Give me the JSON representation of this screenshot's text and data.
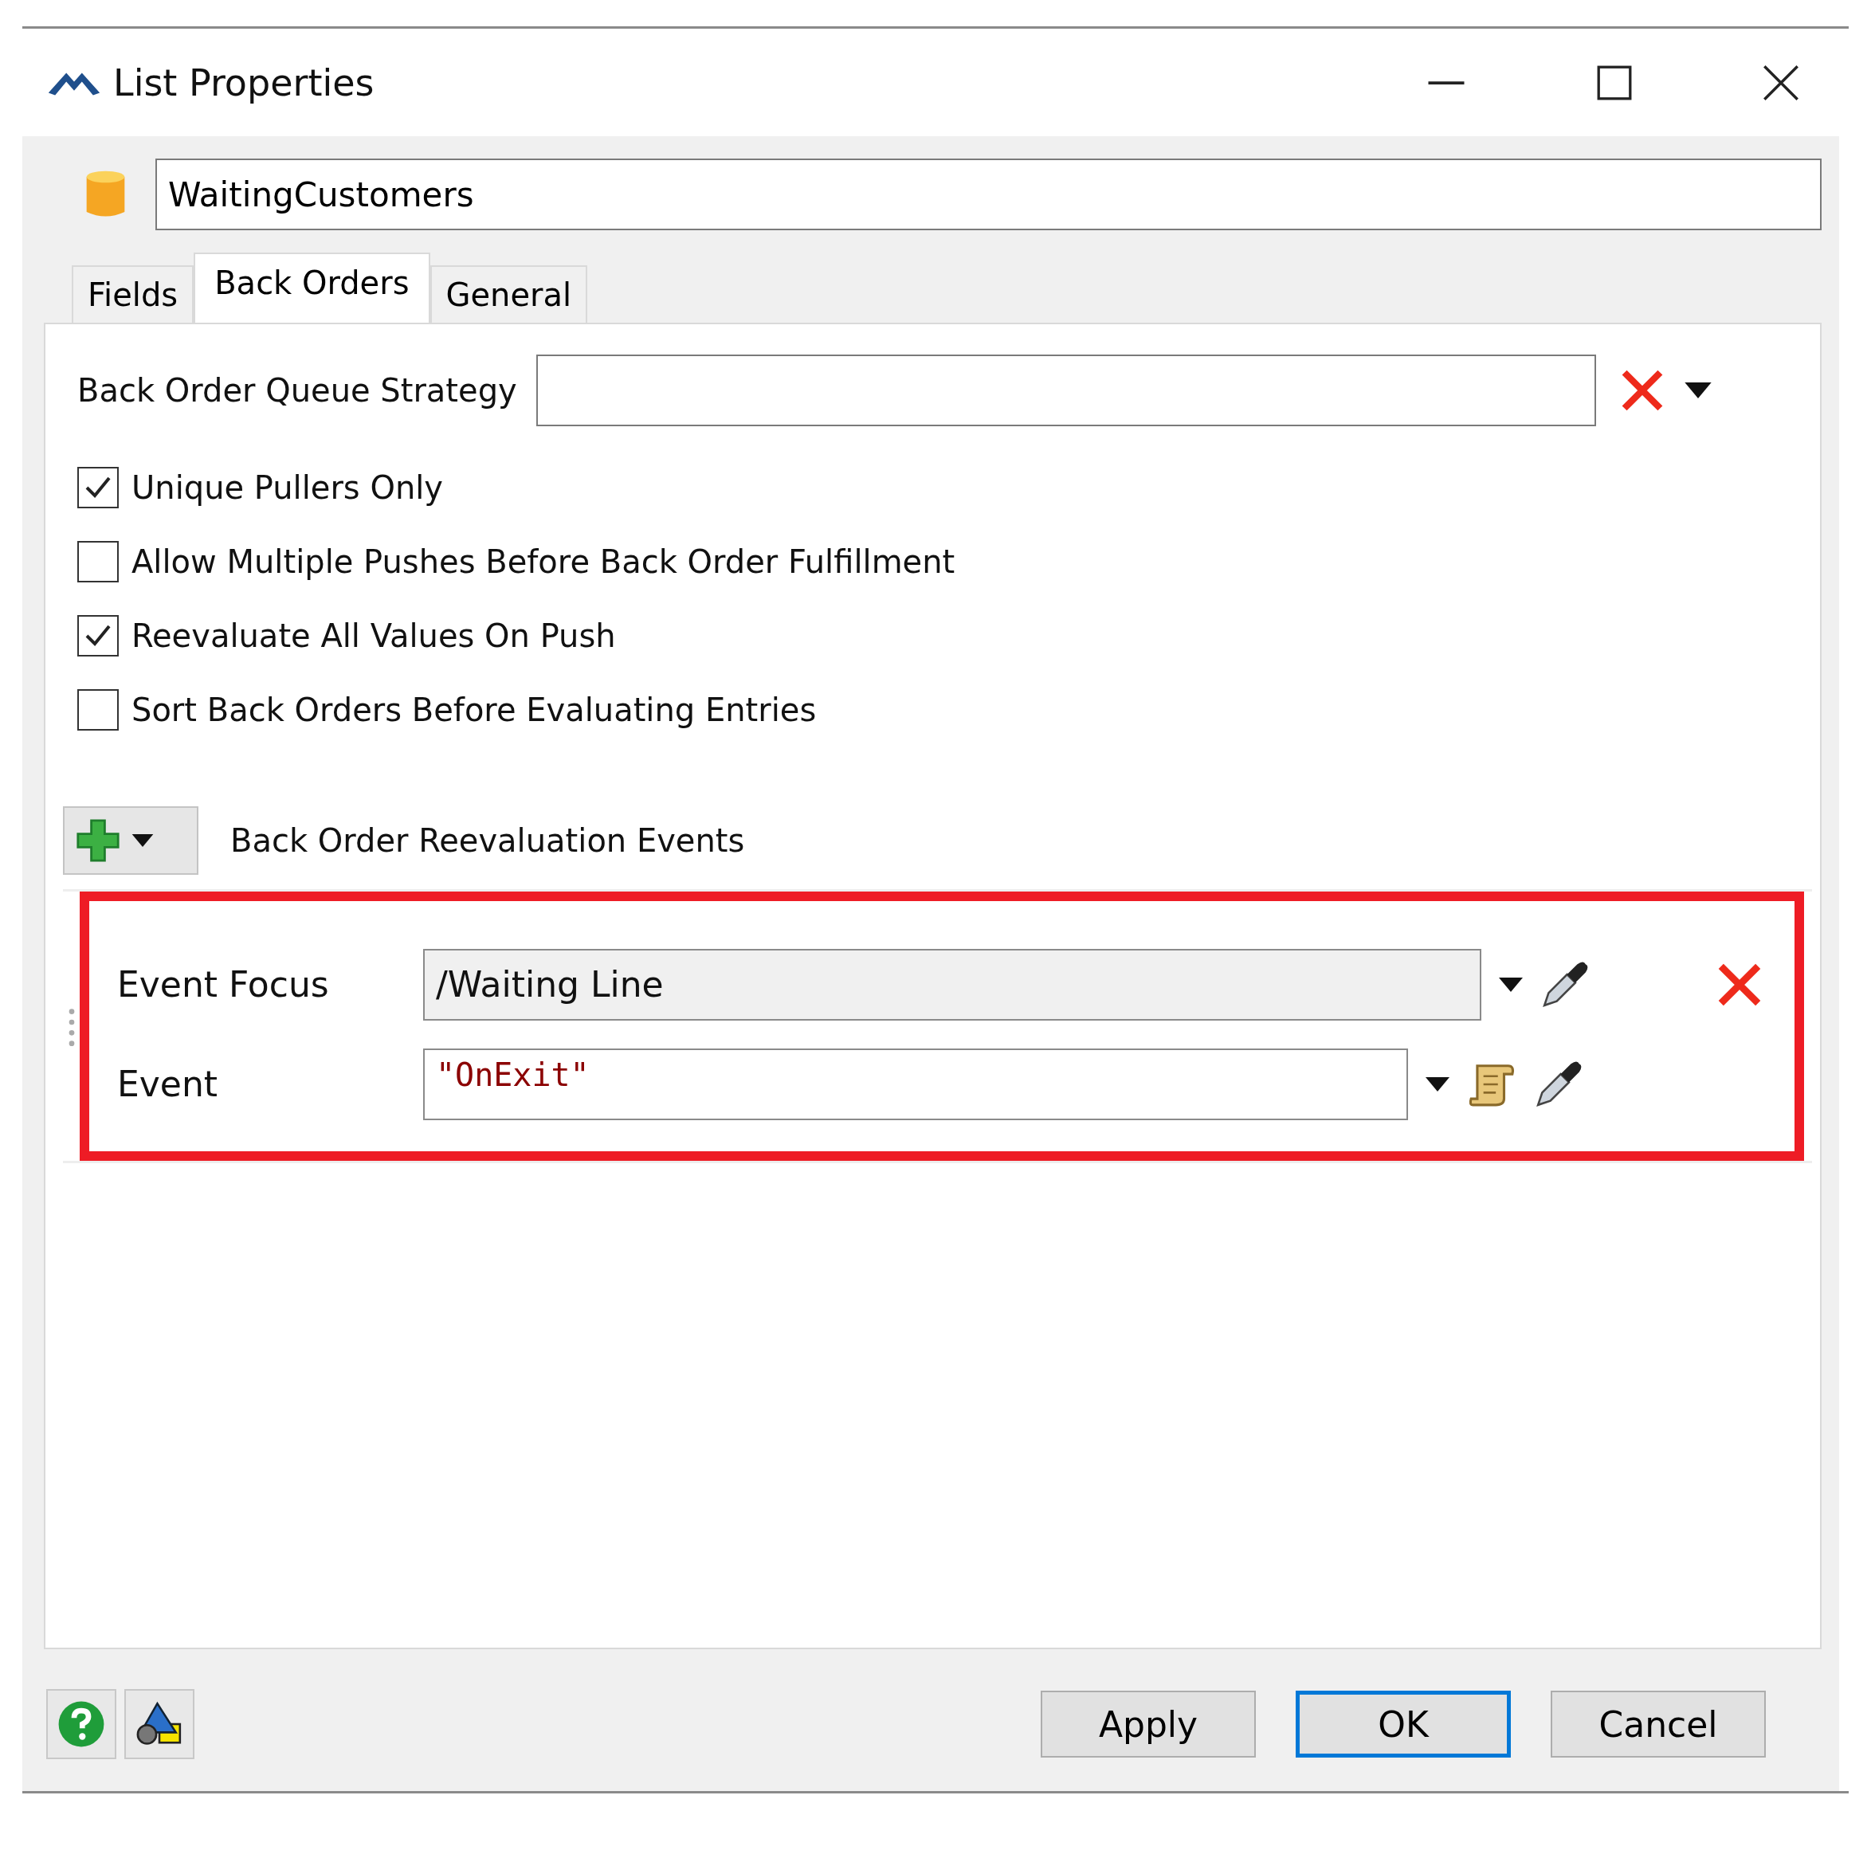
{
  "window": {
    "title": "List Properties"
  },
  "name_field": {
    "value": "WaitingCustomers"
  },
  "tabs": [
    {
      "label": "Fields",
      "selected": false
    },
    {
      "label": "Back Orders",
      "selected": true
    },
    {
      "label": "General",
      "selected": false
    }
  ],
  "queue_strategy": {
    "label": "Back Order Queue Strategy"
  },
  "options": [
    {
      "label": "Unique Pullers Only",
      "checked": true
    },
    {
      "label": "Allow Multiple Pushes Before Back Order Fulfillment",
      "checked": false
    },
    {
      "label": "Reevaluate All Values On Push",
      "checked": true
    },
    {
      "label": "Sort Back Orders Before Evaluating Entries",
      "checked": false
    }
  ],
  "events": {
    "title": "Back Order Reevaluation Events",
    "highlighted": true,
    "rows": [
      {
        "label": "Event Focus",
        "value": "/Waiting Line",
        "kind": "path"
      },
      {
        "label": "Event",
        "value": "\"OnExit\"",
        "kind": "code"
      }
    ]
  },
  "buttons": [
    {
      "label": "Apply",
      "selected": false
    },
    {
      "label": "OK",
      "selected": true
    },
    {
      "label": "Cancel",
      "selected": false
    }
  ]
}
